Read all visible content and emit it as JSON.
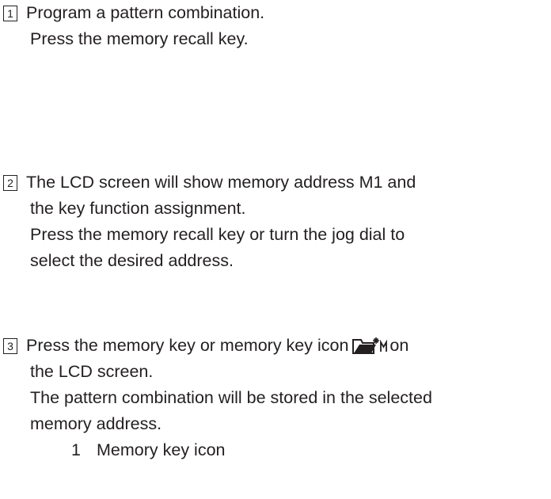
{
  "steps": [
    {
      "number": "1",
      "lines": [
        "Program a pattern combination.",
        "Press the memory recall key."
      ]
    },
    {
      "number": "2",
      "lines": [
        "The LCD screen will show memory address M1 and",
        "the key function assignment.",
        "Press the memory recall key or turn the jog dial to",
        "select the desired address."
      ]
    },
    {
      "number": "3",
      "line1_before_icon": "Press the memory key or memory key icon",
      "line1_after_icon": "on",
      "icon_name": "memory-key-icon",
      "lines": [
        "the LCD screen.",
        "The pattern combination will be stored in the selected",
        "memory address."
      ],
      "callout": {
        "number": "1",
        "label": "Memory key icon"
      }
    }
  ]
}
